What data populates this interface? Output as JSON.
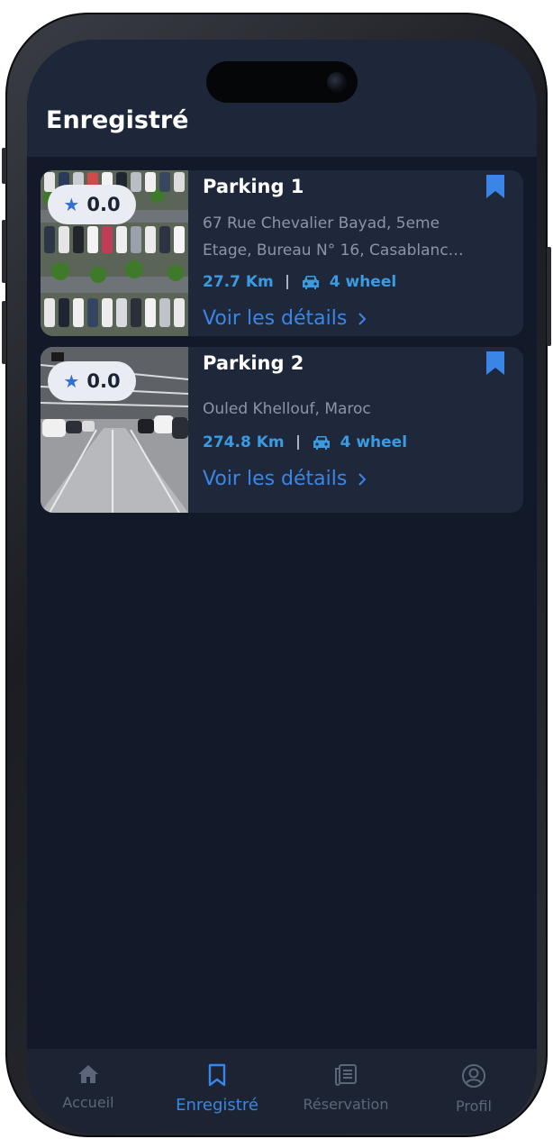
{
  "header": {
    "title": "Enregistré"
  },
  "parkings": [
    {
      "name": "Parking 1",
      "rating": "0.0",
      "address": "67 Rue Chevalier Bayad, 5eme Etage, Bureau N° 16, Casablanc…",
      "address_line1": "67 Rue Chevalier Bayad, 5eme",
      "address_line2": "Etage, Bureau N° 16, Casablanc…",
      "distance": "27.7 Km",
      "vehicle": "4 wheel",
      "details_label": "Voir les détails",
      "bookmarked": true
    },
    {
      "name": "Parking 2",
      "rating": "0.0",
      "address": "Ouled Khellouf, Maroc",
      "distance": "274.8 Km",
      "vehicle": "4 wheel",
      "details_label": "Voir les détails",
      "bookmarked": true
    }
  ],
  "tabbar": {
    "items": [
      {
        "label": "Accueil",
        "icon": "home-icon",
        "active": false
      },
      {
        "label": "Enregistré",
        "icon": "bookmark-icon",
        "active": true
      },
      {
        "label": "Réservation",
        "icon": "newspaper-icon",
        "active": false
      },
      {
        "label": "Profil",
        "icon": "user-circle-icon",
        "active": false
      }
    ]
  },
  "colors": {
    "background": "#121a2a",
    "card": "#1f283a",
    "accent": "#3a86e6",
    "meta": "#3b9be0",
    "muted": "#8c95a6"
  }
}
